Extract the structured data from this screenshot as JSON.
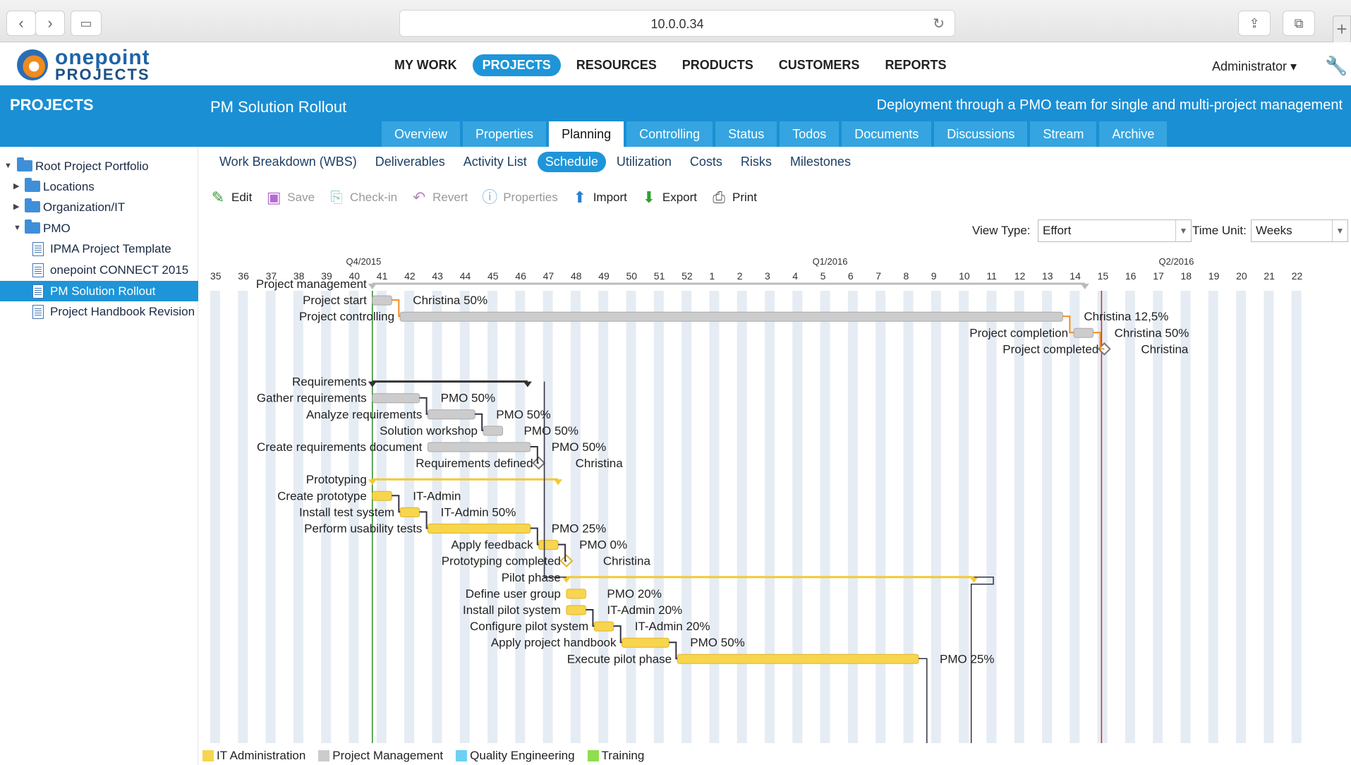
{
  "browser": {
    "url": "10.0.0.34",
    "icons": [
      "back-icon",
      "forward-icon",
      "sidebar-icon",
      "reload-icon",
      "share-icon",
      "tabs-icon",
      "new-tab-icon"
    ]
  },
  "app": {
    "logo_line1": "onepoint",
    "logo_line2": "PROJECTS",
    "nav": [
      "MY WORK",
      "PROJECTS",
      "RESOURCES",
      "PRODUCTS",
      "CUSTOMERS",
      "REPORTS"
    ],
    "active_nav": "PROJECTS",
    "user_menu": "Administrator ▾",
    "accent": "#1a8fd4"
  },
  "sidebar": {
    "title": "PROJECTS",
    "items": [
      {
        "label": "Root Project Portfolio",
        "type": "folder"
      },
      {
        "label": "Locations",
        "type": "folder"
      },
      {
        "label": "Organization/IT",
        "type": "folder"
      },
      {
        "label": "PMO",
        "type": "folder"
      },
      {
        "label": "IPMA Project Template",
        "type": "template"
      },
      {
        "label": "onepoint CONNECT 2015",
        "type": "project"
      },
      {
        "label": "PM Solution Rollout",
        "type": "project",
        "selected": true
      },
      {
        "label": "Project Handbook Revision",
        "type": "project"
      }
    ]
  },
  "project": {
    "title": "PM Solution Rollout",
    "description": "Deployment through a PMO team for single and multi-project management",
    "tabs": [
      "Overview",
      "Properties",
      "Planning",
      "Controlling",
      "Status",
      "Todos",
      "Documents",
      "Discussions",
      "Stream",
      "Archive"
    ],
    "active_tab": "Planning",
    "sub_tabs": [
      "Work Breakdown (WBS)",
      "Deliverables",
      "Activity List",
      "Schedule",
      "Utilization",
      "Costs",
      "Risks",
      "Milestones"
    ],
    "active_sub_tab": "Schedule"
  },
  "toolbar": {
    "edit": "Edit",
    "save": "Save",
    "checkin": "Check-in",
    "revert": "Revert",
    "properties": "Properties",
    "import": "Import",
    "export": "Export",
    "print": "Print"
  },
  "view": {
    "view_type_label": "View Type:",
    "view_type_value": "Effort",
    "time_unit_label": "Time Unit:",
    "time_unit_value": "Weeks"
  },
  "gantt": {
    "quarters": [
      "Q4/2015",
      "Q1/2016",
      "Q2/2016"
    ],
    "weeks": [
      "35",
      "36",
      "37",
      "38",
      "39",
      "40",
      "41",
      "42",
      "43",
      "44",
      "45",
      "46",
      "47",
      "48",
      "49",
      "50",
      "51",
      "52",
      "1",
      "2",
      "3",
      "4",
      "5",
      "6",
      "7",
      "8",
      "9",
      "10",
      "11",
      "12",
      "13",
      "14",
      "15",
      "16",
      "17",
      "18",
      "19",
      "20",
      "21",
      "22"
    ],
    "colors": {
      "it_admin": "#f7d54e",
      "project_management": "#cccccc",
      "quality_engineering": "#6cd0f5",
      "training": "#8ede4e",
      "dependency": "#f28c1e",
      "today": "#2a8a2a",
      "deadline": "#c03030"
    },
    "rows": [
      {
        "name": "Project management",
        "kind": "summary",
        "color": "grey",
        "start": 41,
        "end": 66.7,
        "label": ""
      },
      {
        "name": "Project start",
        "kind": "task",
        "color": "grey",
        "start": 41,
        "end": 41.7,
        "label": "Christina 50%"
      },
      {
        "name": "Project controlling",
        "kind": "task",
        "color": "grey",
        "start": 42,
        "end": 65.9,
        "label": "Christina 12,5%"
      },
      {
        "name": "Project completion",
        "kind": "task",
        "color": "grey",
        "start": 66.3,
        "end": 67,
        "label": "Christina 50%"
      },
      {
        "name": "Project completed",
        "kind": "milestone",
        "color": "grey",
        "start": 67.4,
        "end": 67.4,
        "label": "Christina"
      },
      {
        "name": "",
        "kind": "blank"
      },
      {
        "name": "Requirements",
        "kind": "summary",
        "color": "dark",
        "start": 41,
        "end": 46.6,
        "label": ""
      },
      {
        "name": "Gather requirements",
        "kind": "task",
        "color": "grey",
        "start": 41,
        "end": 42.7,
        "label": "PMO 50%"
      },
      {
        "name": "Analyze requirements",
        "kind": "task",
        "color": "grey",
        "start": 43,
        "end": 44.7,
        "label": "PMO 50%"
      },
      {
        "name": "Solution workshop",
        "kind": "task",
        "color": "grey",
        "start": 45,
        "end": 45.7,
        "label": "PMO 50%"
      },
      {
        "name": "Create requirements document",
        "kind": "task",
        "color": "grey",
        "start": 43,
        "end": 46.7,
        "label": "PMO 50%"
      },
      {
        "name": "Requirements defined",
        "kind": "milestone",
        "color": "grey",
        "start": 47,
        "end": 47,
        "label": "Christina"
      },
      {
        "name": "Prototyping",
        "kind": "summary",
        "color": "yellow",
        "start": 41,
        "end": 47.7,
        "label": ""
      },
      {
        "name": "Create prototype",
        "kind": "task",
        "color": "yellow",
        "start": 41,
        "end": 41.7,
        "label": "IT-Admin"
      },
      {
        "name": "Install test system",
        "kind": "task",
        "color": "yellow",
        "start": 42,
        "end": 42.7,
        "label": "IT-Admin 50%"
      },
      {
        "name": "Perform usability tests",
        "kind": "task",
        "color": "yellow",
        "start": 43,
        "end": 46.7,
        "label": "PMO 25%"
      },
      {
        "name": "Apply feedback",
        "kind": "task",
        "color": "yellow",
        "start": 47,
        "end": 47.7,
        "label": "PMO 0%"
      },
      {
        "name": "Prototyping completed",
        "kind": "milestone",
        "color": "yellow",
        "start": 48,
        "end": 48,
        "label": "Christina"
      },
      {
        "name": "Pilot phase",
        "kind": "summary",
        "color": "yellow",
        "start": 48,
        "end": 62.7,
        "label": ""
      },
      {
        "name": "Define user group",
        "kind": "task",
        "color": "yellow",
        "start": 48,
        "end": 48.7,
        "label": "PMO 20%"
      },
      {
        "name": "Install pilot system",
        "kind": "task",
        "color": "yellow",
        "start": 48,
        "end": 48.7,
        "label": "IT-Admin 20%"
      },
      {
        "name": "Configure pilot system",
        "kind": "task",
        "color": "yellow",
        "start": 49,
        "end": 49.7,
        "label": "IT-Admin 20%"
      },
      {
        "name": "Apply project handbook",
        "kind": "task",
        "color": "yellow",
        "start": 50,
        "end": 51.7,
        "label": "PMO 50%"
      },
      {
        "name": "Execute pilot phase",
        "kind": "task",
        "color": "yellow",
        "start": 52,
        "end": 60.7,
        "label": "PMO 25%"
      }
    ]
  },
  "legend": [
    {
      "label": "IT Administration",
      "color": "#f7d54e"
    },
    {
      "label": "Project Management",
      "color": "#cccccc"
    },
    {
      "label": "Quality Engineering",
      "color": "#6cd0f5"
    },
    {
      "label": "Training",
      "color": "#8ede4e"
    }
  ]
}
